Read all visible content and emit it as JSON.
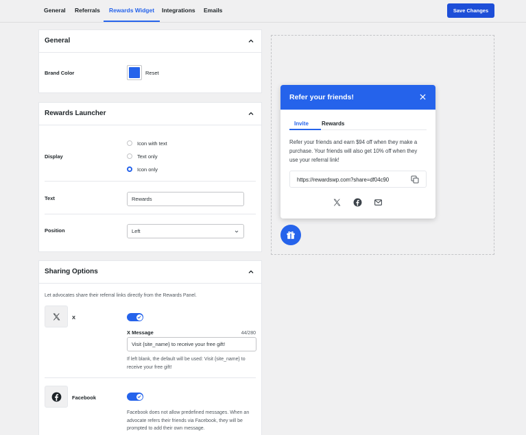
{
  "nav": {
    "tabs": [
      "General",
      "Referrals",
      "Rewards Widget",
      "Integrations",
      "Emails"
    ],
    "active_tab": "Rewards Widget",
    "save_label": "Save Changes"
  },
  "general": {
    "title": "General",
    "brand_color_label": "Brand Color",
    "brand_color": "#2563eb",
    "reset_label": "Reset"
  },
  "launcher": {
    "title": "Rewards Launcher",
    "display_label": "Display",
    "display_options": [
      "Icon with text",
      "Text only",
      "Icon only"
    ],
    "display_selected": "Icon only",
    "text_label": "Text",
    "text_value": "Rewards",
    "position_label": "Position",
    "position_value": "Left"
  },
  "sharing": {
    "title": "Sharing Options",
    "description": "Let advocates share their referral links directly from the Rewards Panel.",
    "x": {
      "label": "X",
      "enabled": true,
      "message_label": "X Message",
      "counter": "44/280",
      "message_value": "Visit {site_name} to receive your free gift!",
      "help": "If left blank, the default will be used: Visit {site_name} to receive your free gift!"
    },
    "facebook": {
      "label": "Facebook",
      "enabled": true,
      "help": "Facebook does not allow predefined messages. When an advocate refers their friends via Facebook, they will be prompted to add their own message."
    }
  },
  "widget": {
    "title": "Refer your friends!",
    "tabs": [
      "Invite",
      "Rewards"
    ],
    "active_tab": "Invite",
    "body": "Refer your friends and earn $94 off when they make a purchase. Your friends will also get 10% off when they use your referral link!",
    "share_url": "https://rewardswp.com?share=df04c90",
    "share_icons": [
      "x-icon",
      "facebook-icon",
      "email-icon"
    ]
  }
}
